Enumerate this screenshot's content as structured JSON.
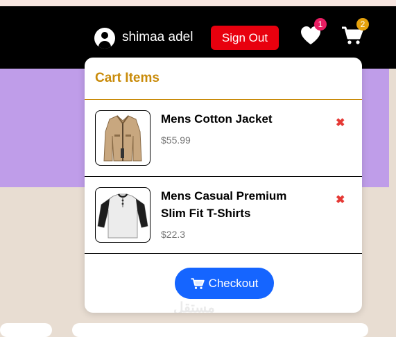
{
  "navbar": {
    "user_icon": "user-circle-icon",
    "user_name": "shimaa adel",
    "sign_out_label": "Sign Out",
    "favorites_icon": "heart-icon",
    "favorites_count": "1",
    "cart_icon": "cart-icon",
    "cart_count": "2"
  },
  "cart": {
    "title": "Cart Items",
    "items": [
      {
        "name": "Mens Cotton Jacket",
        "price": "$55.99",
        "remove_label": "✖",
        "image": "jacket-image"
      },
      {
        "name": "Mens Casual Premium Slim Fit T-Shirts",
        "price": "$22.3",
        "remove_label": "✖",
        "image": "tshirt-image"
      }
    ],
    "checkout_label": "Checkout",
    "checkout_icon": "cart-icon"
  },
  "watermark": "مستقل",
  "colors": {
    "navbar": "#000000",
    "sign_out": "#e8000e",
    "cart_title": "#c98b0a",
    "checkout": "#1565ff",
    "remove": "#e53935",
    "favorites_badge": "#e91e63",
    "cart_badge": "#e5a10c",
    "purple_band": "#bf9de9"
  }
}
